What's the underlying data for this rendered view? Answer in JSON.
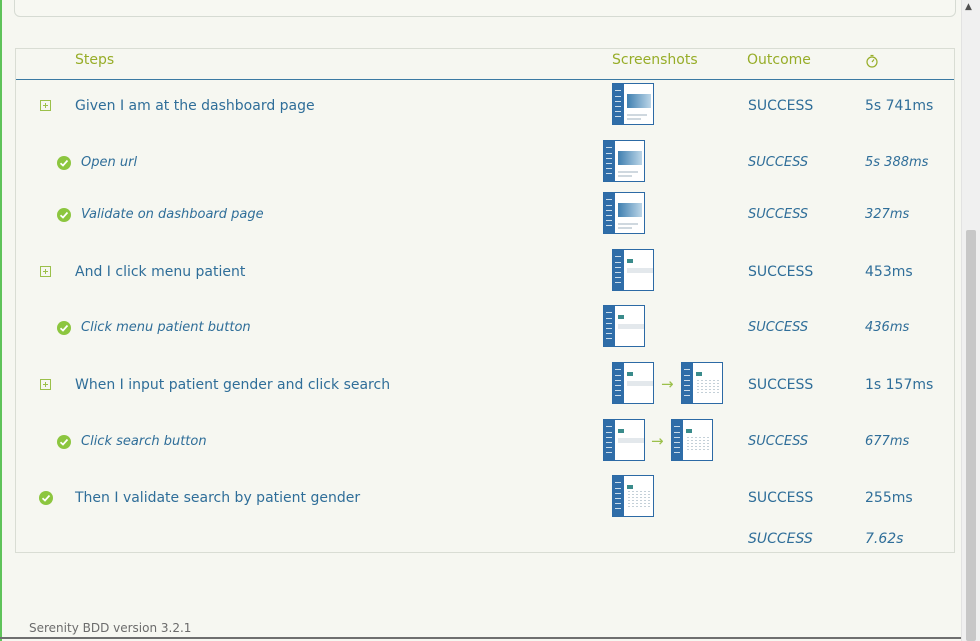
{
  "header": {
    "steps": "Steps",
    "screenshots": "Screenshots",
    "outcome": "Outcome",
    "duration_icon": "stopwatch-icon"
  },
  "rows": [
    {
      "label": "Given I am at the dashboard page",
      "outcome": "SUCCESS",
      "duration": "5s 741ms",
      "icon": "expand-icon",
      "type": "step"
    },
    {
      "label": "Open url",
      "outcome": "SUCCESS",
      "duration": "5s 388ms",
      "icon": "check-circle-icon",
      "type": "sub"
    },
    {
      "label": "Validate on dashboard page",
      "outcome": "SUCCESS",
      "duration": "327ms",
      "icon": "check-circle-icon",
      "type": "sub"
    },
    {
      "label": "And I click menu patient",
      "outcome": "SUCCESS",
      "duration": "453ms",
      "icon": "expand-icon",
      "type": "step"
    },
    {
      "label": "Click menu patient button",
      "outcome": "SUCCESS",
      "duration": "436ms",
      "icon": "check-circle-icon",
      "type": "sub"
    },
    {
      "label": "When I input patient gender and click search",
      "outcome": "SUCCESS",
      "duration": "1s 157ms",
      "icon": "expand-icon",
      "type": "step"
    },
    {
      "label": "Click search button",
      "outcome": "SUCCESS",
      "duration": "677ms",
      "icon": "check-circle-icon",
      "type": "sub"
    },
    {
      "label": "Then I validate search by patient gender",
      "outcome": "SUCCESS",
      "duration": "255ms",
      "icon": "check-circle-icon",
      "type": "step"
    }
  ],
  "total": {
    "outcome": "SUCCESS",
    "duration": "7.62s"
  },
  "arrow_glyph": "→",
  "footer": {
    "version": "Serenity BDD version 3.2.1"
  },
  "colors": {
    "accent_green": "#97ad28",
    "link_blue": "#2f6e99",
    "success_green": "#8cc63f"
  }
}
